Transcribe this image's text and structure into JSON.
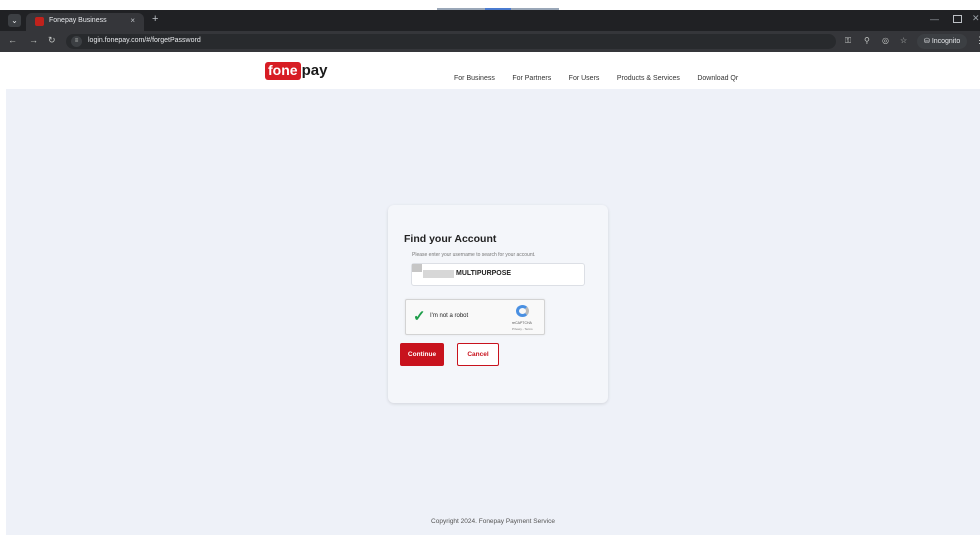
{
  "browser": {
    "tab_title": "Fonepay Business",
    "tab_close": "×",
    "new_tab": "+",
    "url": "login.fonepay.com/#/forgetPassword",
    "incognito_label": "Incognito"
  },
  "site": {
    "logo_fone": "fone",
    "logo_pay": "pay",
    "nav": [
      "For Business",
      "For Partners",
      "For Users",
      "Products & Services",
      "Download Qr"
    ]
  },
  "form": {
    "title": "Find your Account",
    "subtitle": "Please enter your username to search for your account.",
    "username_value": "MULTIPURPOSE",
    "captcha_label": "I'm not a robot",
    "captcha_brand": "reCAPTCHA",
    "captcha_terms": "Privacy - Terms",
    "continue_label": "Continue",
    "cancel_label": "Cancel"
  },
  "footer": {
    "copyright": "Copyright 2024. Fonepay Payment Service"
  },
  "colors": {
    "brand_red": "#c8121d",
    "page_bg": "#eef1f8",
    "browser_dark": "#202124"
  }
}
